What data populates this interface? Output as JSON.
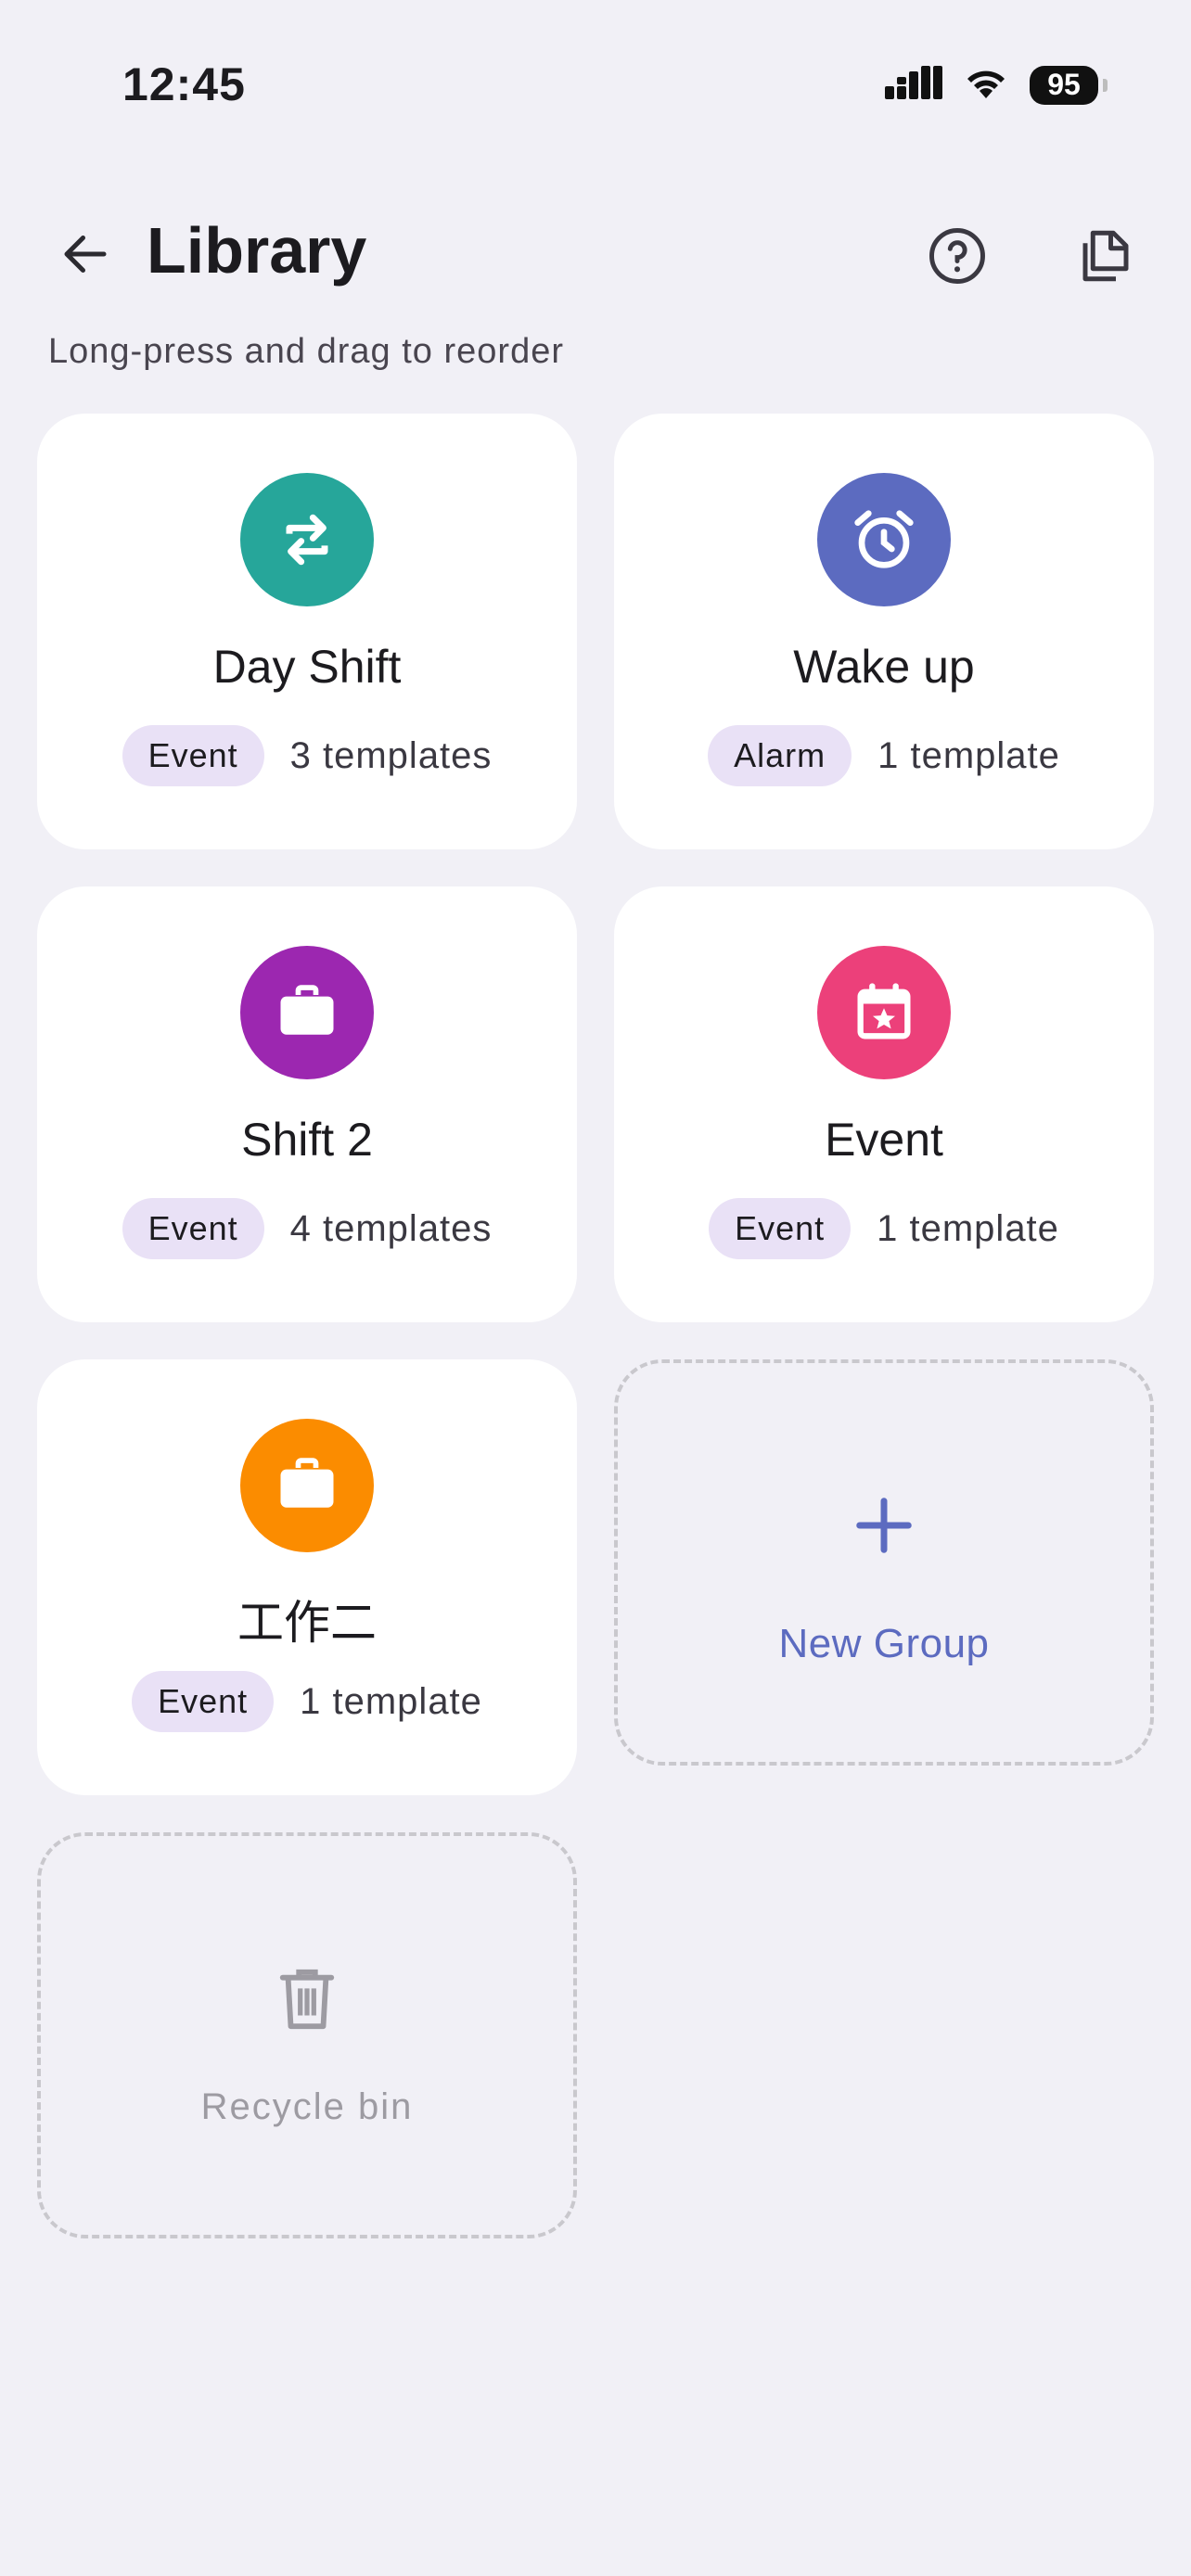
{
  "status_bar": {
    "time": "12:45",
    "battery": "95",
    "icons": [
      "signal-icon",
      "wifi-icon",
      "battery-icon"
    ]
  },
  "header": {
    "title": "Library",
    "back_icon": "arrow-left-icon",
    "help_icon": "help-circle-icon",
    "copy_icon": "copy-icon"
  },
  "hint": "Long-press and drag to reorder",
  "groups": [
    {
      "name": "Day Shift",
      "type": "Event",
      "count": "3 templates",
      "icon": "repeat-icon",
      "color": "#26a69a"
    },
    {
      "name": "Wake up",
      "type": "Alarm",
      "count": "1 template",
      "icon": "alarm-clock-icon",
      "color": "#5c6bc0"
    },
    {
      "name": "Shift 2",
      "type": "Event",
      "count": "4 templates",
      "icon": "briefcase-icon",
      "color": "#9c27b0"
    },
    {
      "name": "Event",
      "type": "Event",
      "count": "1 template",
      "icon": "calendar-star-icon",
      "color": "#ec407a"
    },
    {
      "name": "工作二",
      "type": "Event",
      "count": "1 template",
      "icon": "briefcase-icon",
      "color": "#fb8c00"
    }
  ],
  "new_group": {
    "label": "New Group",
    "icon": "plus-icon",
    "color": "#5c6bc0"
  },
  "recycle_bin": {
    "label": "Recycle bin",
    "icon": "trash-icon"
  },
  "colors": {
    "background": "#f1f0f6",
    "card": "#ffffff",
    "badge": "#e9e1f6",
    "accent": "#5c6bc0"
  }
}
